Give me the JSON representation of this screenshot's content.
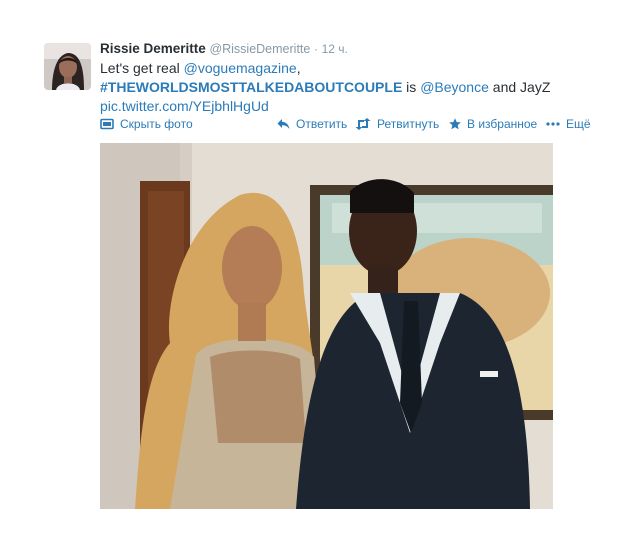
{
  "tweet": {
    "fullname": "Rissie Demeritte",
    "username": "@RissieDemeritte",
    "separator": "·",
    "time": "12 ч.",
    "text": {
      "prefix": "Let's get real ",
      "mention1": "@voguemagazine",
      "comma": ",",
      "hashtag": "#THEWORLDSMOSTTALKEDABOUTCOUPLE",
      "is_text": " is ",
      "mention2": "@Beyonce",
      "and_text": " and JayZ",
      "link": "pic.twitter.com/YEjbhlHgUd"
    }
  },
  "actions": {
    "hide_photo": "Скрыть фото",
    "reply": "Ответить",
    "retweet": "Ретвитнуть",
    "favorite": "В избранное",
    "more": "Ещё"
  },
  "icons": {
    "hide_photo": "photo-icon",
    "reply": "reply-icon",
    "retweet": "retweet-icon",
    "favorite": "star-icon",
    "more": "more-dots-icon"
  },
  "colors": {
    "link": "#2b7bb9",
    "muted": "#8899a6",
    "text": "#292f33"
  }
}
